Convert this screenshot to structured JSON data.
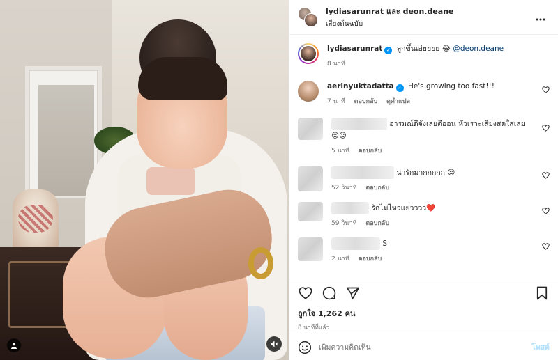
{
  "header": {
    "owner": "lydiasarunrat และ deon.deane",
    "audio": "เสียงต้นฉบับ",
    "more_icon": "more-horizontal-icon"
  },
  "caption": {
    "username": "lydiasarunrat",
    "text": "ลูกขึ้นเอ่ยยยย 😂",
    "mention": "@deon.deane",
    "time": "8 นาที"
  },
  "comments": [
    {
      "username": "aerinyuktadatta",
      "verified": true,
      "text": "He's growing too fast!!!",
      "time": "7 นาที",
      "reply": "ตอบกลับ",
      "translate": "ดูคำแปล"
    },
    {
      "username": "",
      "text": "อารมณ์ดีจังเลยดีออน หัวเราะเสียงสดใสเลย 😍😍",
      "text2": "😍😍",
      "time": "5 นาที",
      "reply": "ตอบกลับ"
    },
    {
      "username": "",
      "text": "น่ารักมากกกกก 😍",
      "time": "52 วินาที",
      "reply": "ตอบกลับ"
    },
    {
      "username": "",
      "text": "รักไม่ไหวแย่วววว❤️",
      "time": "59 วินาที",
      "reply": "ตอบกลับ"
    },
    {
      "username": "",
      "text": "S",
      "time": "2 นาที",
      "reply": "ตอบกลับ"
    }
  ],
  "stats": {
    "likes": "ถูกใจ 1,262 คน",
    "time_ago": "8 นาทีที่แล้ว"
  },
  "composer": {
    "placeholder": "เพิ่มความคิดเห็น",
    "post": "โพสต์"
  },
  "colors": {
    "verified": "#0095f6",
    "post_disabled": "#b2dffc",
    "secondary_text": "#737373"
  }
}
